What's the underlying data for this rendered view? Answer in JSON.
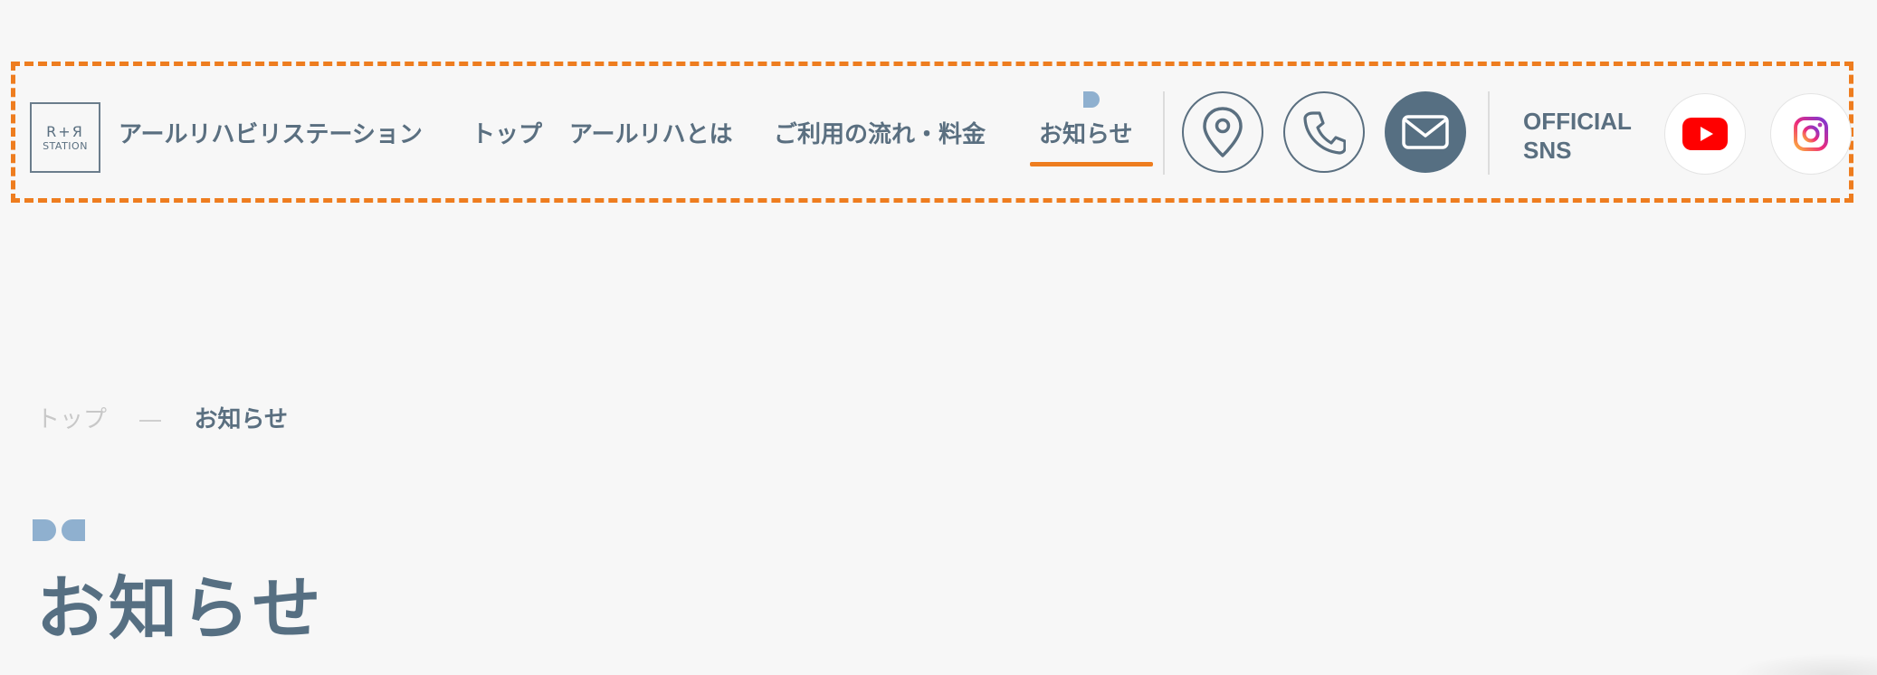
{
  "header": {
    "logo": {
      "mark": "R+Я",
      "text": "STATION"
    },
    "nav": [
      {
        "label": "アールリハビリステーション"
      },
      {
        "label": "トップ"
      },
      {
        "label": "アールリハとは"
      },
      {
        "label": "ご利用の流れ・料金"
      },
      {
        "label": "お知らせ",
        "active": true
      }
    ],
    "actions": {
      "location_icon": "map-pin-icon",
      "phone_icon": "phone-icon",
      "mail_icon": "mail-icon"
    },
    "sns": {
      "label_line1": "OFFICIAL",
      "label_line2": "SNS",
      "items": [
        "youtube-icon",
        "instagram-icon"
      ]
    }
  },
  "breadcrumb": {
    "home": "トップ",
    "current": "お知らせ"
  },
  "page": {
    "title": "お知らせ"
  },
  "colors": {
    "accent": "#ee7d1f",
    "primary_text": "#5a6f80",
    "deco_blue": "#8fb0cf",
    "background": "#f7f7f7"
  }
}
